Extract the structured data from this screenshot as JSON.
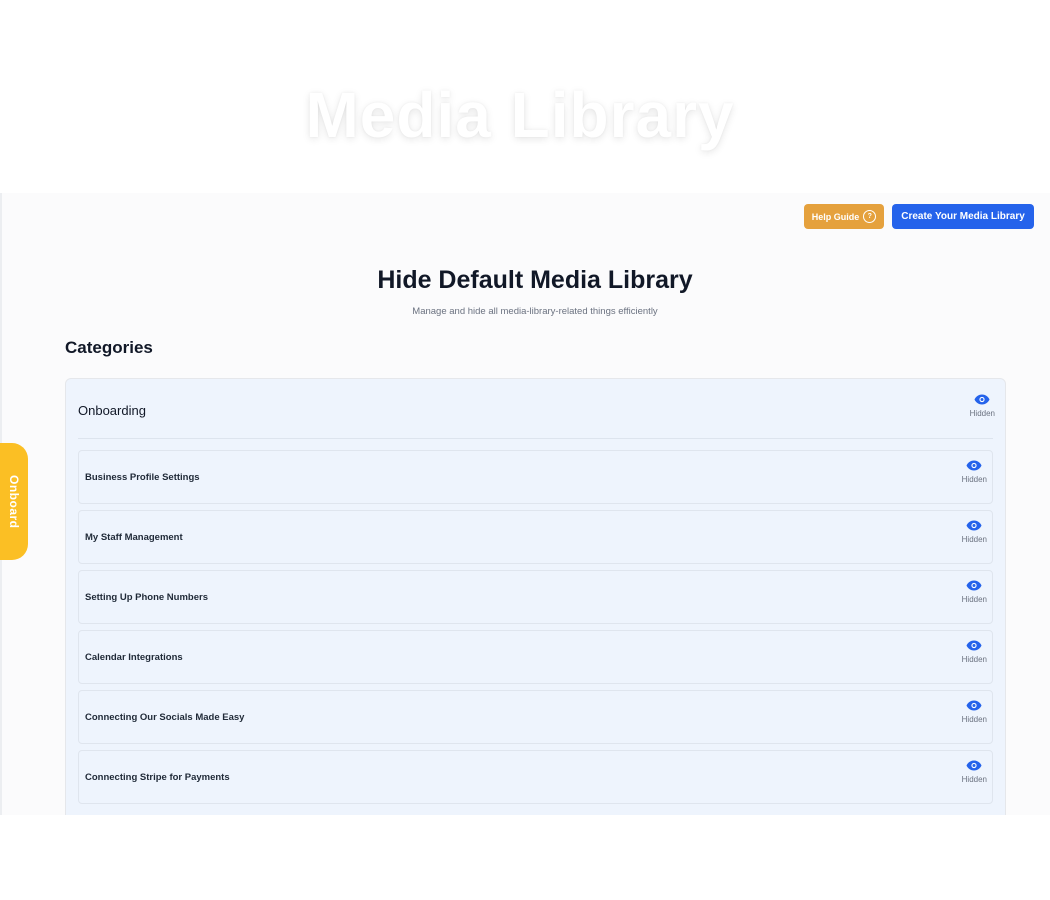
{
  "hero": {
    "title": "Media Library"
  },
  "toolbar": {
    "help_label": "Help Guide",
    "help_icon": "question-circle-icon",
    "create_label": "Create Your Media Library"
  },
  "header": {
    "title": "Hide Default Media Library",
    "subtitle": "Manage and hide all media-library-related things efficiently"
  },
  "categories": {
    "heading": "Categories",
    "group": {
      "name": "Onboarding",
      "status": "Hidden",
      "items": [
        {
          "name": "Business Profile Settings",
          "status": "Hidden"
        },
        {
          "name": "My Staff Management",
          "status": "Hidden"
        },
        {
          "name": "Setting Up Phone Numbers",
          "status": "Hidden"
        },
        {
          "name": "Calendar Integrations",
          "status": "Hidden"
        },
        {
          "name": "Connecting Our Socials Made Easy",
          "status": "Hidden"
        },
        {
          "name": "Connecting Stripe for Payments",
          "status": "Hidden"
        }
      ]
    }
  },
  "side_tab": {
    "label": "Onboard"
  },
  "colors": {
    "primary": "#2563eb",
    "help": "#e5a13d",
    "side_tab": "#fbbf24",
    "card_bg": "#eef4fd"
  }
}
